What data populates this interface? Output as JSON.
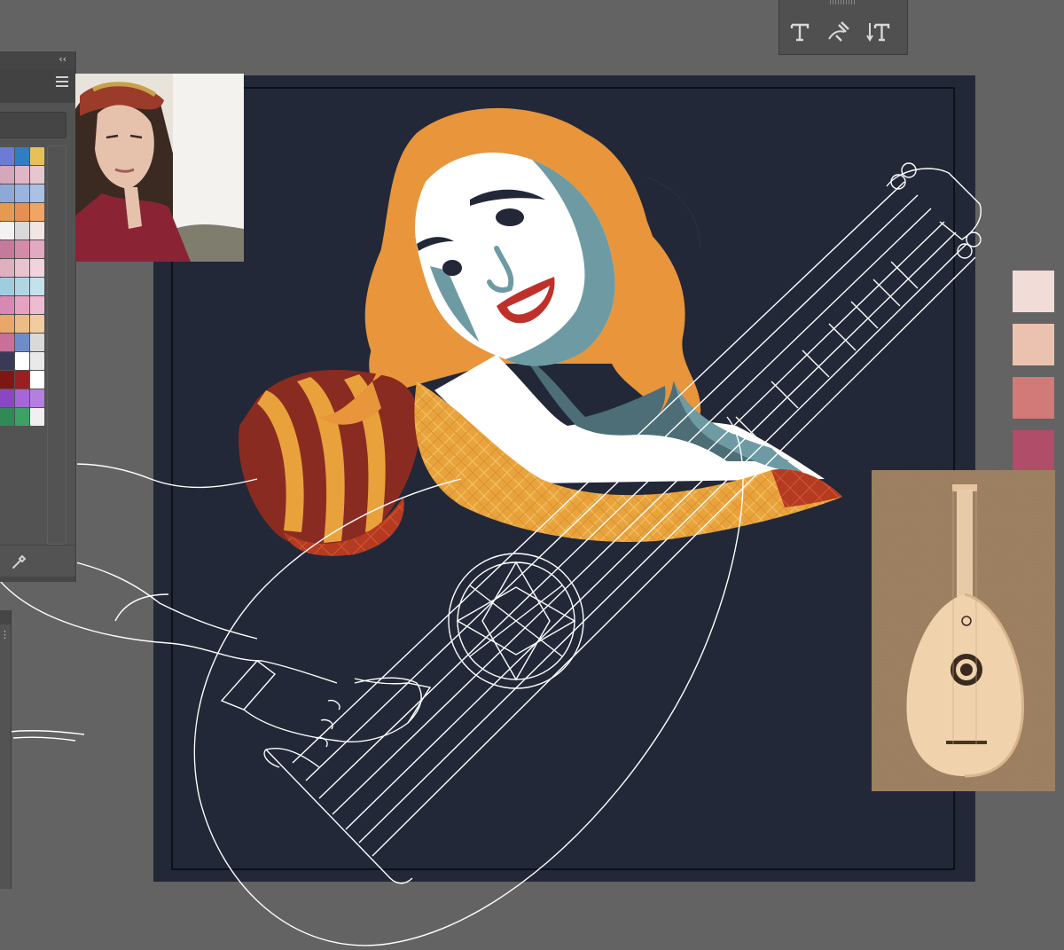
{
  "workspace": {
    "background": "#636363"
  },
  "artboard": {
    "background": "#222838"
  },
  "swatches_panel": {
    "collapse_label": "‹‹",
    "menu_icon": "hamburger-menu-icon",
    "swatch_rows": [
      [
        "#6c7bd4",
        "#2f7ec4",
        "#e7c05a"
      ],
      [
        "#d4a7b9",
        "#e0b5c6",
        "#e8c6cf"
      ],
      [
        "#8fa8d8",
        "#9ab3df",
        "#aac1e3"
      ],
      [
        "#e59a4f",
        "#e58f52",
        "#f0a564"
      ],
      [
        "#f2f2f2",
        "#d9d9d9",
        "#f0e6e2"
      ],
      [
        "#c57a9b",
        "#d38ba8",
        "#e2a9c1"
      ],
      [
        "#e0b0c0",
        "#e9c3cf",
        "#f0d3dc"
      ],
      [
        "#9fcde0",
        "#b0d6e4",
        "#c4e1ec"
      ],
      [
        "#d68ab3",
        "#e6a2c3",
        "#efbbd2"
      ],
      [
        "#e7a86a",
        "#edbb84",
        "#f2cc9e"
      ],
      [
        "#c86f9a",
        "#6e8cc9",
        "#d9d9d9"
      ],
      [
        "#3a3a58",
        "#ffffff",
        "#e9e9e9"
      ],
      [
        "#7f1616",
        "#9b1e22",
        "#ffffff"
      ],
      [
        "#8a47c4",
        "#a566d8",
        "#b57fe0"
      ],
      [
        "#2f8a55",
        "#3ea065",
        "#f0f0f0"
      ]
    ]
  },
  "toolbar": {
    "tools": [
      {
        "name": "type-tool",
        "glyph": "T"
      },
      {
        "name": "type-on-path-tool",
        "glyph": "⤼T"
      },
      {
        "name": "vertical-type-tool",
        "glyph": "↓T"
      }
    ]
  },
  "palette": {
    "chips": [
      "#f1dcd8",
      "#ebc2b0",
      "#d27a78",
      "#b04d69"
    ]
  },
  "illustration": {
    "hair_color": "#e8953c",
    "skin_light": "#ffffff",
    "skin_shadow": "#6e9ba3",
    "skin_deep": "#4d6e76",
    "lips": "#c0302a",
    "sleeve_red": "#8a2b21",
    "sleeve_gold": "#e9a23b",
    "collar_gold": "#e9a33d",
    "line_color": "#ffffff"
  }
}
